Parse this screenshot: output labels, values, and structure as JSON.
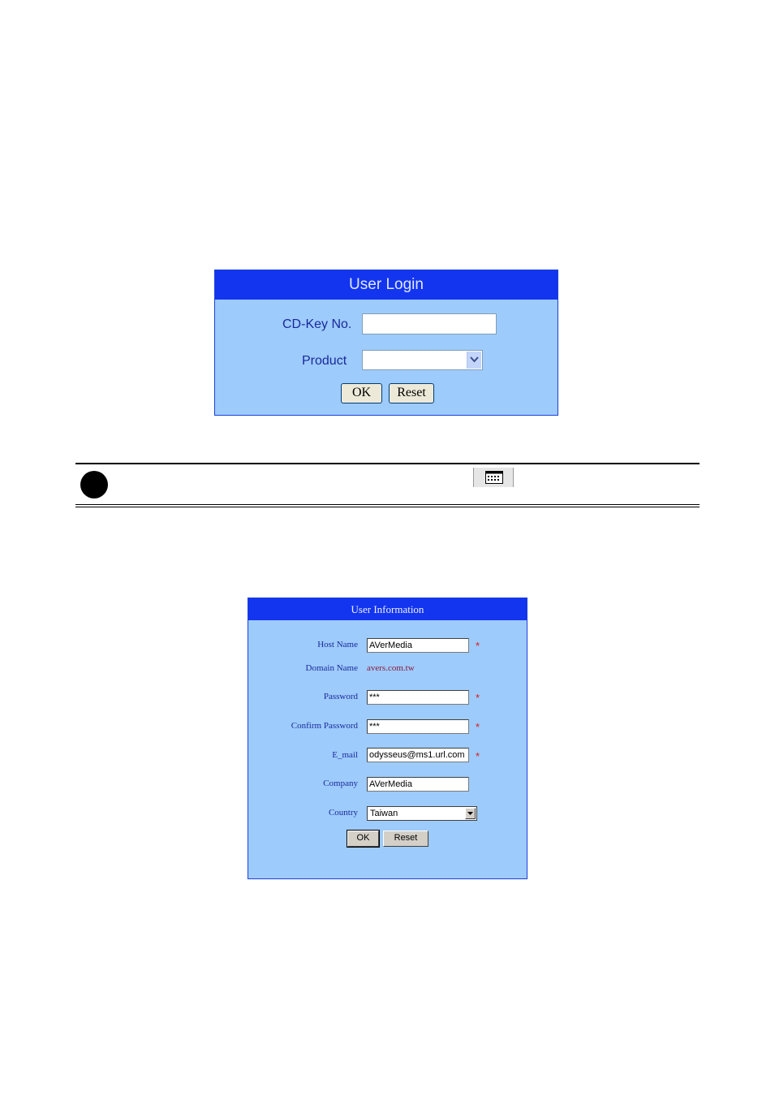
{
  "login": {
    "title": "User Login",
    "cdkey_label": "CD-Key No.",
    "cdkey_value": "",
    "product_label": "Product",
    "product_value": "",
    "ok_label": "OK",
    "reset_label": "Reset"
  },
  "note": {
    "icons": [
      "note-bullet-icon",
      "calendar-icon"
    ]
  },
  "user_info": {
    "title": "User Information",
    "host_label": "Host Name",
    "host_value": "AVerMedia",
    "domain_label": "Domain Name",
    "domain_value": "avers.com.tw",
    "password_label": "Password",
    "password_value": "***",
    "confirm_label": "Confirm Password",
    "confirm_value": "***",
    "email_label": "E_mail",
    "email_value": "odysseus@ms1.url.com",
    "company_label": "Company",
    "company_value": "AVerMedia",
    "country_label": "Country",
    "country_value": "Taiwan",
    "required_mark": "*",
    "ok_label": "OK",
    "reset_label": "Reset"
  },
  "colors": {
    "panel_bg": "#9dcbfc",
    "title_bg": "#1335f0",
    "label_text": "#1a2a9a",
    "required": "#e01818"
  }
}
